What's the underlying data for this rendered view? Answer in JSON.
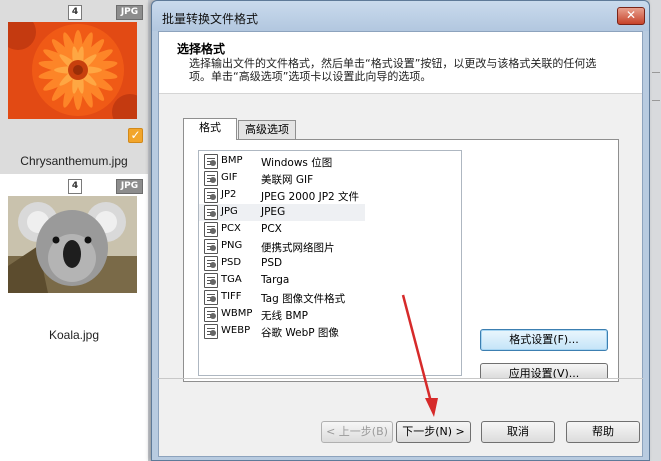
{
  "thumbnails": [
    {
      "number": "4",
      "type": "JPG",
      "label": "Chrysanthemum.jpg",
      "selected": true,
      "check_icon": "checkmark-icon"
    },
    {
      "number": "4",
      "type": "JPG",
      "label": "Koala.jpg",
      "selected": false
    }
  ],
  "dialog": {
    "title": "批量转换文件格式",
    "close_label": "✕",
    "header_title": "选择格式",
    "header_desc": "选择输出文件的文件格式，然后单击“格式设置”按钮，以更改与该格式关联的任何选项。单击“高级选项”选项卡以设置此向导的选项。",
    "tabs": [
      {
        "label": "格式",
        "active": true
      },
      {
        "label": "高级选项",
        "active": false
      }
    ],
    "formats": [
      {
        "code": "BMP",
        "desc": "Windows 位图"
      },
      {
        "code": "GIF",
        "desc": "美联网 GIF"
      },
      {
        "code": "JP2",
        "desc": "JPEG 2000 JP2 文件"
      },
      {
        "code": "JPG",
        "desc": "JPEG"
      },
      {
        "code": "PCX",
        "desc": "PCX"
      },
      {
        "code": "PNG",
        "desc": "便携式网络图片"
      },
      {
        "code": "PSD",
        "desc": "PSD"
      },
      {
        "code": "TGA",
        "desc": "Targa"
      },
      {
        "code": "TIFF",
        "desc": "Tag 图像文件格式"
      },
      {
        "code": "WBMP",
        "desc": "无线 BMP"
      },
      {
        "code": "WEBP",
        "desc": "谷歌 WebP 图像"
      }
    ],
    "highlighted_format": "JPG",
    "buttons": {
      "format_settings": "格式设置(F)...",
      "apply_settings": "应用设置(V)...",
      "prev": "< 上一步(B)",
      "next": "下一步(N) >",
      "cancel": "取消",
      "help": "帮助"
    }
  },
  "colors": {
    "arrow": "#d62a2a",
    "title_bg": "#b8cbe0"
  }
}
